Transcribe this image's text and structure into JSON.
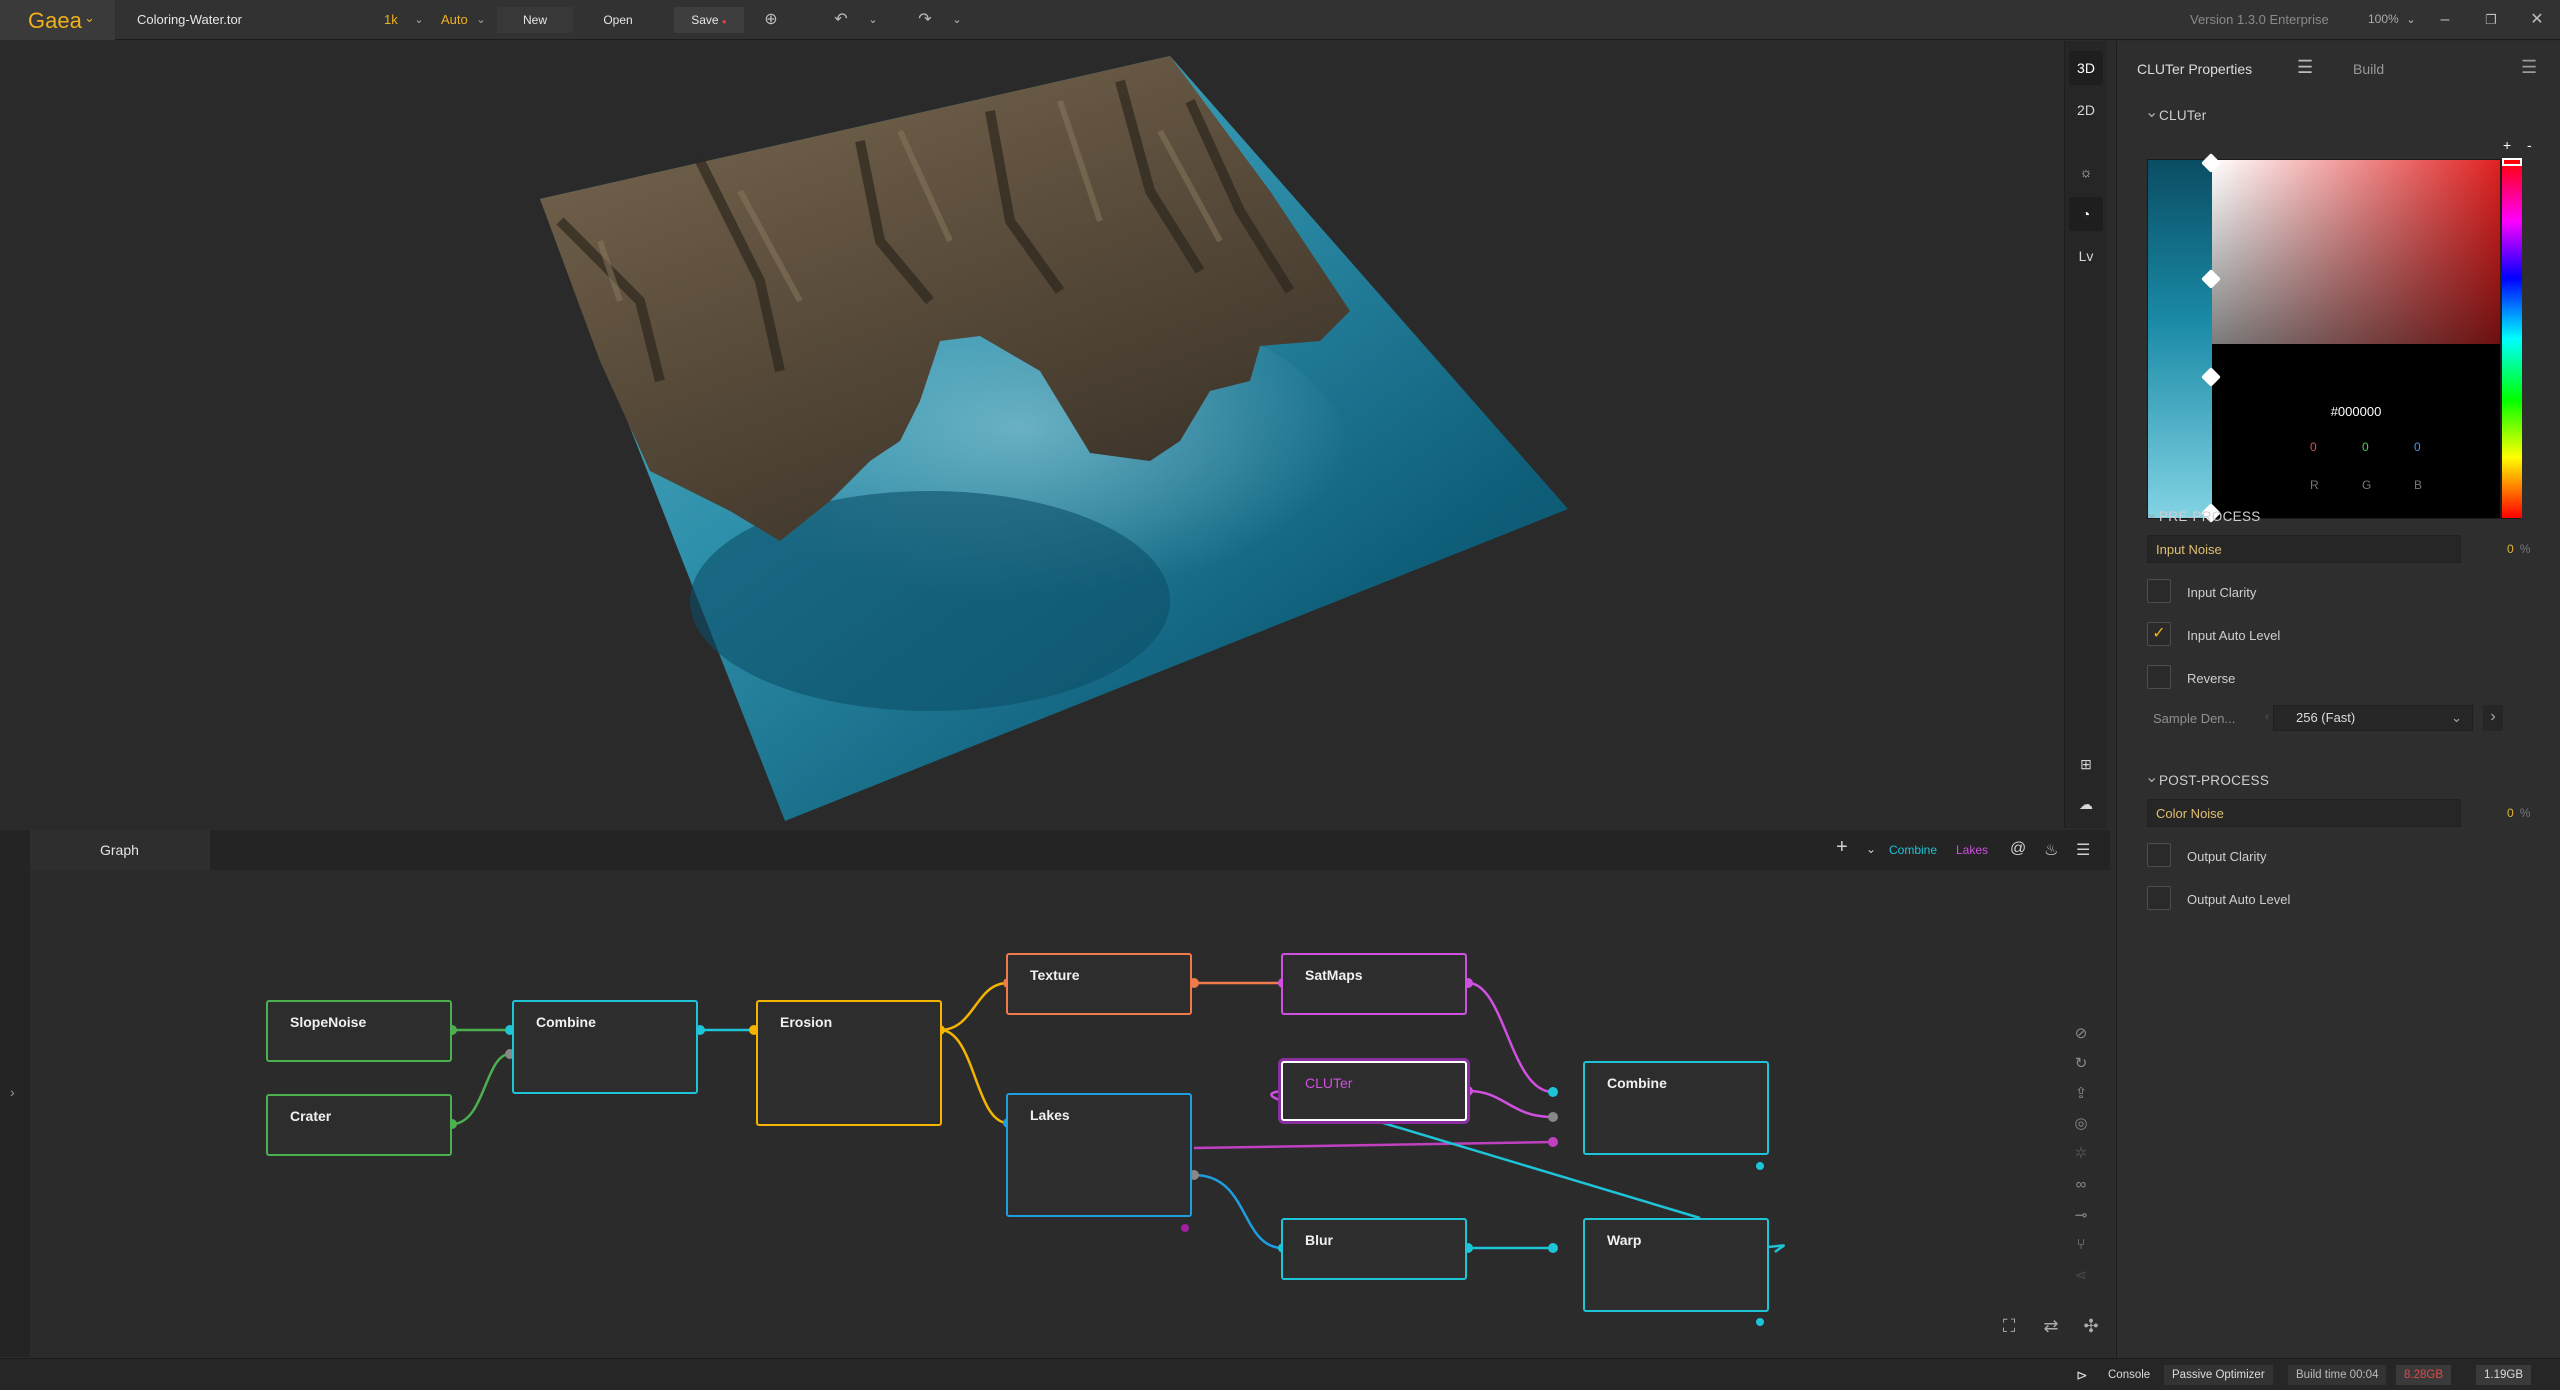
{
  "app": {
    "name": "Gaea",
    "file": "Coloring-Water.tor",
    "resolution": "1k",
    "build_mode": "Auto",
    "version": "Version 1.3.0 Enterprise",
    "zoom": "100%"
  },
  "toolbar": {
    "new_label": "New",
    "open_label": "Open",
    "save_label": "Save",
    "save_dot": "●"
  },
  "viewport_tools": {
    "mode3d": "3D",
    "mode2d": "2D",
    "lv": "Lv"
  },
  "panel": {
    "tab_properties": "CLUTer Properties",
    "tab_build": "Build",
    "section_cluter": "CLUTer",
    "color": {
      "hex": "#000000",
      "r": "0",
      "g": "0",
      "b": "0",
      "r_label": "R",
      "g_label": "G",
      "b_label": "B",
      "plus": "+",
      "minus": "-"
    },
    "section_pre": "PRE-PROCESS",
    "input_noise": {
      "label": "Input Noise",
      "value": "0",
      "unit": "%"
    },
    "input_clarity": "Input Clarity",
    "input_auto_level": "Input Auto Level",
    "reverse": "Reverse",
    "sample_density": {
      "label": "Sample Den...",
      "value": "256 (Fast)"
    },
    "section_post": "POST-PROCESS",
    "color_noise": {
      "label": "Color Noise",
      "value": "0",
      "unit": "%"
    },
    "output_clarity": "Output Clarity",
    "output_auto_level": "Output Auto Level"
  },
  "graph": {
    "tab": "Graph",
    "breadcrumb_1": "Combine",
    "breadcrumb_2": "Lakes",
    "nodes": {
      "slopenoise": "SlopeNoise",
      "crater": "Crater",
      "combine1": "Combine",
      "erosion": "Erosion",
      "texture": "Texture",
      "lakes": "Lakes",
      "satmaps": "SatMaps",
      "cluter": "CLUTer",
      "blur": "Blur",
      "combine2": "Combine",
      "warp": "Warp"
    }
  },
  "status": {
    "console": "Console",
    "optimizer": "Passive Optimizer",
    "build_time": "Build time 00:04",
    "mem1": "8.28GB",
    "mem2": "1.19GB"
  },
  "colors": {
    "accent": "#f0b11b",
    "green": "#4caf50",
    "cyan": "#1ec4d8",
    "yellow": "#f5b400",
    "orange": "#f07a4a",
    "magenta": "#d050e0",
    "blue": "#1e9ee0"
  }
}
